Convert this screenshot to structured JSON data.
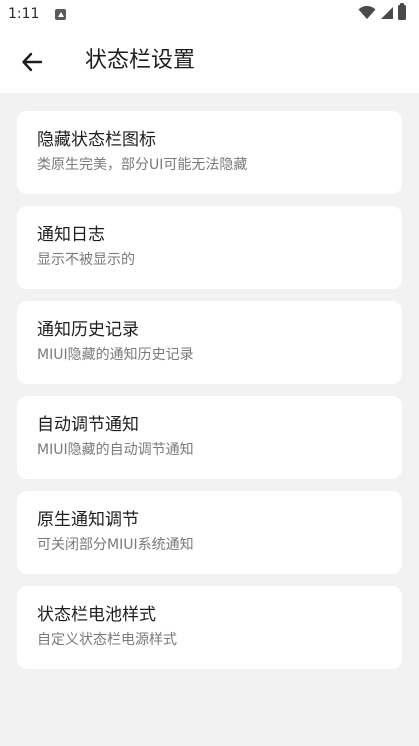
{
  "status_bar": {
    "time": "1:11"
  },
  "app_bar": {
    "title": "状态栏设置"
  },
  "settings": [
    {
      "title": "隐藏状态栏图标",
      "subtitle": "类原生完美，部分UI可能无法隐藏"
    },
    {
      "title": "通知日志",
      "subtitle": "显示不被显示的"
    },
    {
      "title": "通知历史记录",
      "subtitle": "MIUI隐藏的通知历史记录"
    },
    {
      "title": "自动调节通知",
      "subtitle": "MIUI隐藏的自动调节通知"
    },
    {
      "title": "原生通知调节",
      "subtitle": "可关闭部分MIUI系统通知"
    },
    {
      "title": "状态栏电池样式",
      "subtitle": "自定义状态栏电源样式"
    }
  ]
}
